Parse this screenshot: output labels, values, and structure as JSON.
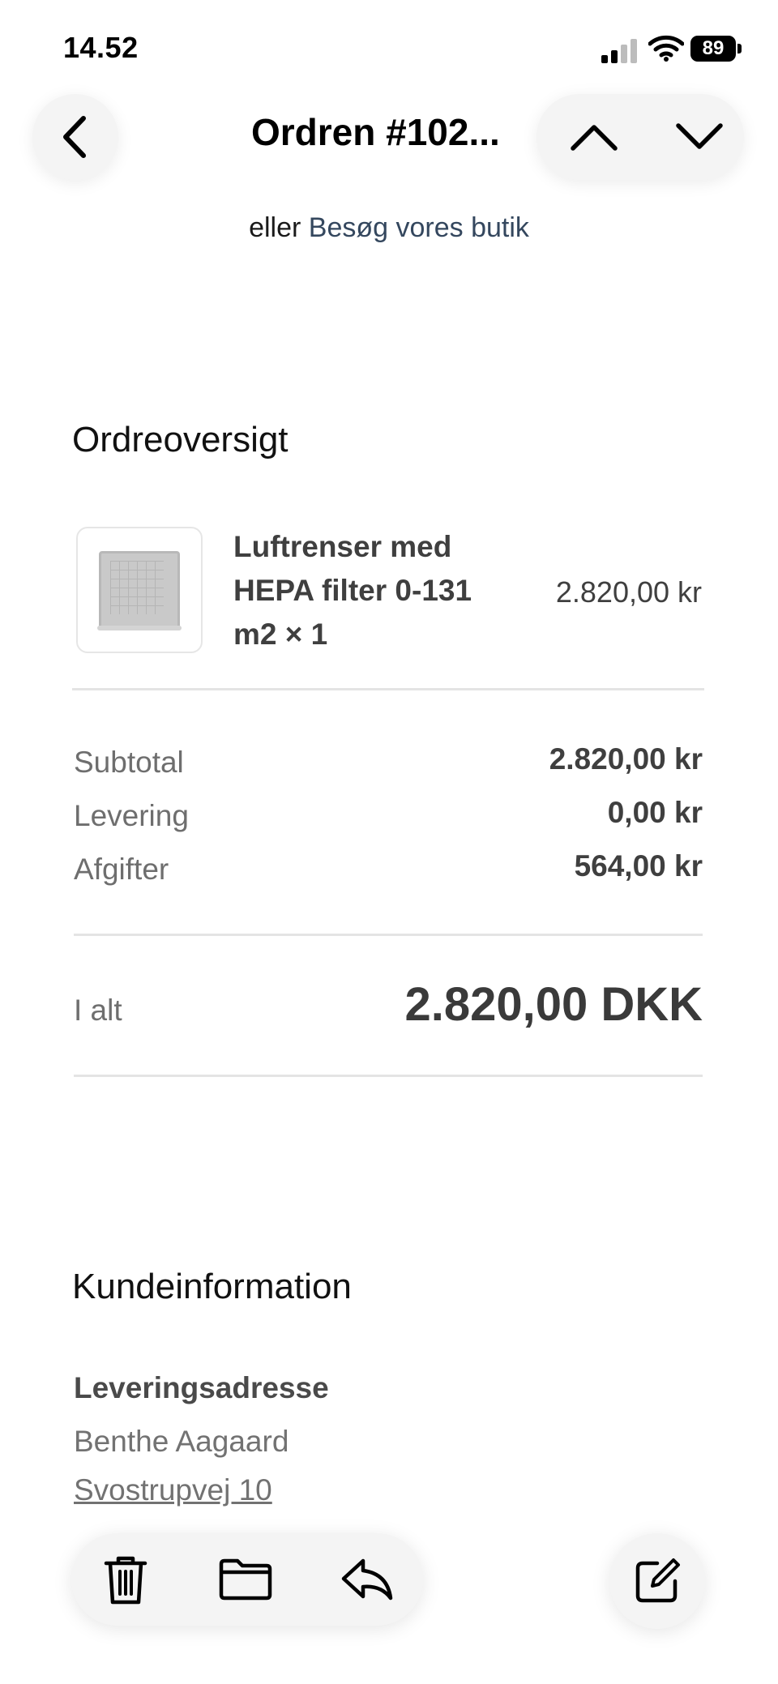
{
  "status_bar": {
    "time": "14.52",
    "battery": "89"
  },
  "header": {
    "title": "Ordren #102..."
  },
  "shop_link": {
    "prefix": "eller",
    "link_text": "Besøg vores butik"
  },
  "order_overview": {
    "title": "Ordreoversigt",
    "item": {
      "name": "Luftrenser med HEPA filter 0-131 m2 × 1",
      "price": "2.820,00 kr"
    },
    "summary": [
      {
        "label": "Subtotal",
        "value": "2.820,00 kr"
      },
      {
        "label": "Levering",
        "value": "0,00 kr"
      },
      {
        "label": "Afgifter",
        "value": "564,00 kr"
      }
    ],
    "total": {
      "label": "I alt",
      "value": "2.820,00 DKK"
    }
  },
  "customer_info": {
    "title": "Kundeinformation",
    "shipping_label": "Leveringsadresse",
    "name": "Benthe Aagaard",
    "street": "Svostrupvej 10"
  },
  "icons": {
    "back": "chevron-left-icon",
    "up": "chevron-up-icon",
    "down": "chevron-down-icon",
    "trash": "trash-icon",
    "folder": "folder-icon",
    "reply": "reply-icon",
    "compose": "compose-icon"
  },
  "colors": {
    "link": "#34475e",
    "muted_text": "#6e6e6e",
    "value_text": "#3f3f3f",
    "divider": "#e4e4e4"
  }
}
